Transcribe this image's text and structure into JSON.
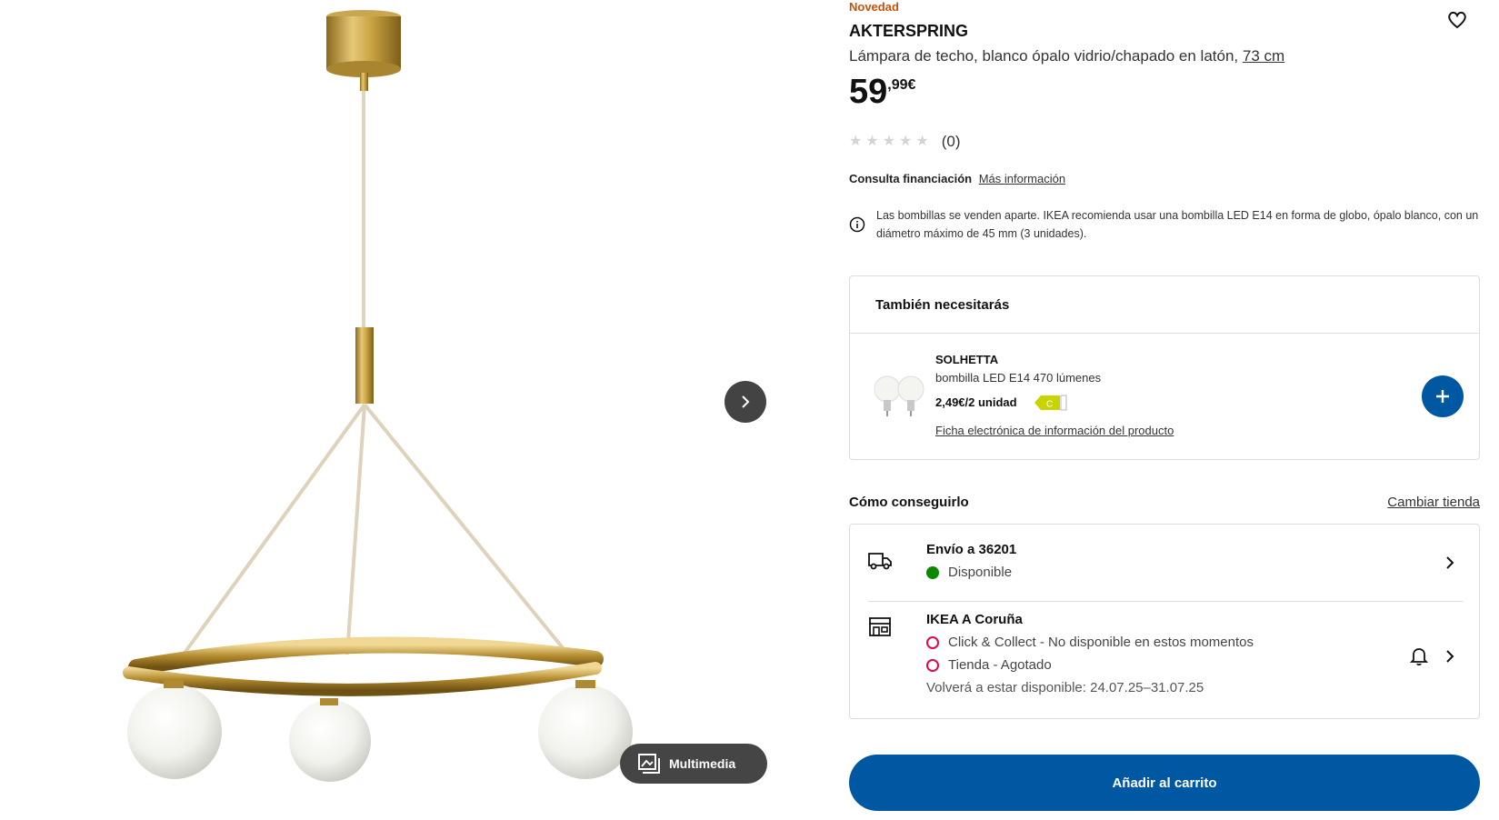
{
  "product": {
    "badge": "Novedad",
    "name": "AKTERSPRING",
    "description": "Lámpara de techo, blanco ópalo vidrio/chapado en latón,",
    "size_link": "73 cm",
    "price_int": "59",
    "price_dec": ",99€",
    "rating_count": "(0)",
    "rating_stars": 0,
    "favorite_icon": "heart-icon"
  },
  "finance": {
    "label": "Consulta financiación",
    "link": "Más información"
  },
  "bulb_note": "Las bombillas se venden aparte. IKEA recomienda usar una bombilla LED E14 en forma de globo, ópalo blanco, con un diámetro máximo de 45 mm (3 unidades).",
  "gallery": {
    "media_label": "Multimedia",
    "next_icon": "chevron-right-icon"
  },
  "also_need": {
    "title": "También necesitarás",
    "item": {
      "name": "SOLHETTA",
      "desc": "bombilla LED E14 470 lúmenes",
      "price": "2,49€/2 unidad",
      "energy_class": "C",
      "link": "Ficha electrónica de información del producto"
    }
  },
  "availability": {
    "title": "Cómo conseguirlo",
    "change_store": "Cambiar tienda",
    "delivery": {
      "title": "Envío a 36201",
      "status": "Disponible",
      "status_color": "#0a8a00"
    },
    "store": {
      "title": "IKEA A Coruña",
      "click_collect": "Click & Collect - No disponible en estos momentos",
      "in_store": "Tienda - Agotado",
      "back_in_stock": "Volverá a estar disponible: 24.07.25–31.07.25",
      "status_color": "#e00751"
    }
  },
  "cart": {
    "label": "Añadir al carrito"
  },
  "colors": {
    "brand_blue": "#0058a3",
    "badge_orange": "#ca5008"
  }
}
